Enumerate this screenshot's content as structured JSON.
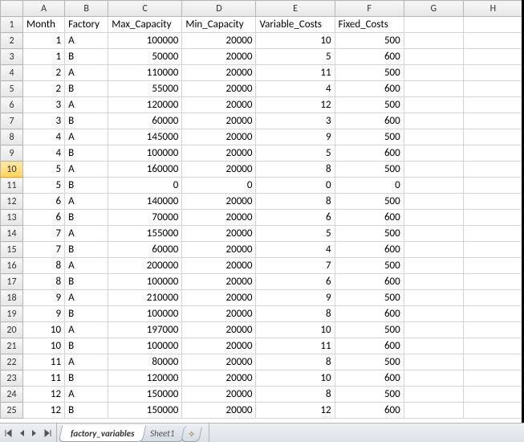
{
  "columns": [
    "A",
    "B",
    "C",
    "D",
    "E",
    "F",
    "G",
    "H"
  ],
  "headers": {
    "A": "Month",
    "B": "Factory",
    "C": "Max_Capacity",
    "D": "Min_Capacity",
    "E": "Variable_Costs",
    "F": "Fixed_Costs"
  },
  "rows": [
    {
      "n": 1,
      "A": "1",
      "B": "A",
      "C": "100000",
      "D": "20000",
      "E": "10",
      "F": "500"
    },
    {
      "n": 2,
      "A": "1",
      "B": "B",
      "C": "50000",
      "D": "20000",
      "E": "5",
      "F": "600"
    },
    {
      "n": 3,
      "A": "2",
      "B": "A",
      "C": "110000",
      "D": "20000",
      "E": "11",
      "F": "500"
    },
    {
      "n": 4,
      "A": "2",
      "B": "B",
      "C": "55000",
      "D": "20000",
      "E": "4",
      "F": "600"
    },
    {
      "n": 5,
      "A": "3",
      "B": "A",
      "C": "120000",
      "D": "20000",
      "E": "12",
      "F": "500"
    },
    {
      "n": 6,
      "A": "3",
      "B": "B",
      "C": "60000",
      "D": "20000",
      "E": "3",
      "F": "600"
    },
    {
      "n": 7,
      "A": "4",
      "B": "A",
      "C": "145000",
      "D": "20000",
      "E": "9",
      "F": "500"
    },
    {
      "n": 8,
      "A": "4",
      "B": "B",
      "C": "100000",
      "D": "20000",
      "E": "5",
      "F": "600"
    },
    {
      "n": 9,
      "A": "5",
      "B": "A",
      "C": "160000",
      "D": "20000",
      "E": "8",
      "F": "500"
    },
    {
      "n": 10,
      "A": "5",
      "B": "B",
      "C": "0",
      "D": "0",
      "E": "0",
      "F": "0"
    },
    {
      "n": 11,
      "A": "6",
      "B": "A",
      "C": "140000",
      "D": "20000",
      "E": "8",
      "F": "500"
    },
    {
      "n": 12,
      "A": "6",
      "B": "B",
      "C": "70000",
      "D": "20000",
      "E": "6",
      "F": "600"
    },
    {
      "n": 13,
      "A": "7",
      "B": "A",
      "C": "155000",
      "D": "20000",
      "E": "5",
      "F": "500"
    },
    {
      "n": 14,
      "A": "7",
      "B": "B",
      "C": "60000",
      "D": "20000",
      "E": "4",
      "F": "600"
    },
    {
      "n": 15,
      "A": "8",
      "B": "A",
      "C": "200000",
      "D": "20000",
      "E": "7",
      "F": "500"
    },
    {
      "n": 16,
      "A": "8",
      "B": "B",
      "C": "100000",
      "D": "20000",
      "E": "6",
      "F": "600"
    },
    {
      "n": 17,
      "A": "9",
      "B": "A",
      "C": "210000",
      "D": "20000",
      "E": "9",
      "F": "500"
    },
    {
      "n": 18,
      "A": "9",
      "B": "B",
      "C": "100000",
      "D": "20000",
      "E": "8",
      "F": "600"
    },
    {
      "n": 19,
      "A": "10",
      "B": "A",
      "C": "197000",
      "D": "20000",
      "E": "10",
      "F": "500"
    },
    {
      "n": 20,
      "A": "10",
      "B": "B",
      "C": "100000",
      "D": "20000",
      "E": "11",
      "F": "600"
    },
    {
      "n": 21,
      "A": "11",
      "B": "A",
      "C": "80000",
      "D": "20000",
      "E": "8",
      "F": "500"
    },
    {
      "n": 22,
      "A": "11",
      "B": "B",
      "C": "120000",
      "D": "20000",
      "E": "10",
      "F": "600"
    },
    {
      "n": 23,
      "A": "12",
      "B": "A",
      "C": "150000",
      "D": "20000",
      "E": "8",
      "F": "500"
    },
    {
      "n": 24,
      "A": "12",
      "B": "B",
      "C": "150000",
      "D": "20000",
      "E": "12",
      "F": "600"
    }
  ],
  "selected_row_header": 10,
  "tabs": {
    "active": "factory_variables",
    "items": [
      "factory_variables",
      "Sheet1"
    ]
  },
  "chart_data": {
    "type": "table",
    "title": "Factory capacity and cost variables by month",
    "columns": [
      "Month",
      "Factory",
      "Max_Capacity",
      "Min_Capacity",
      "Variable_Costs",
      "Fixed_Costs"
    ],
    "data": [
      [
        1,
        "A",
        100000,
        20000,
        10,
        500
      ],
      [
        1,
        "B",
        50000,
        20000,
        5,
        600
      ],
      [
        2,
        "A",
        110000,
        20000,
        11,
        500
      ],
      [
        2,
        "B",
        55000,
        20000,
        4,
        600
      ],
      [
        3,
        "A",
        120000,
        20000,
        12,
        500
      ],
      [
        3,
        "B",
        60000,
        20000,
        3,
        600
      ],
      [
        4,
        "A",
        145000,
        20000,
        9,
        500
      ],
      [
        4,
        "B",
        100000,
        20000,
        5,
        600
      ],
      [
        5,
        "A",
        160000,
        20000,
        8,
        500
      ],
      [
        5,
        "B",
        0,
        0,
        0,
        0
      ],
      [
        6,
        "A",
        140000,
        20000,
        8,
        500
      ],
      [
        6,
        "B",
        70000,
        20000,
        6,
        600
      ],
      [
        7,
        "A",
        155000,
        20000,
        5,
        500
      ],
      [
        7,
        "B",
        60000,
        20000,
        4,
        600
      ],
      [
        8,
        "A",
        200000,
        20000,
        7,
        500
      ],
      [
        8,
        "B",
        100000,
        20000,
        6,
        600
      ],
      [
        9,
        "A",
        210000,
        20000,
        9,
        500
      ],
      [
        9,
        "B",
        100000,
        20000,
        8,
        600
      ],
      [
        10,
        "A",
        197000,
        20000,
        10,
        500
      ],
      [
        10,
        "B",
        100000,
        20000,
        11,
        600
      ],
      [
        11,
        "A",
        80000,
        20000,
        8,
        500
      ],
      [
        11,
        "B",
        120000,
        20000,
        10,
        600
      ],
      [
        12,
        "A",
        150000,
        20000,
        8,
        500
      ],
      [
        12,
        "B",
        150000,
        20000,
        12,
        600
      ]
    ]
  }
}
